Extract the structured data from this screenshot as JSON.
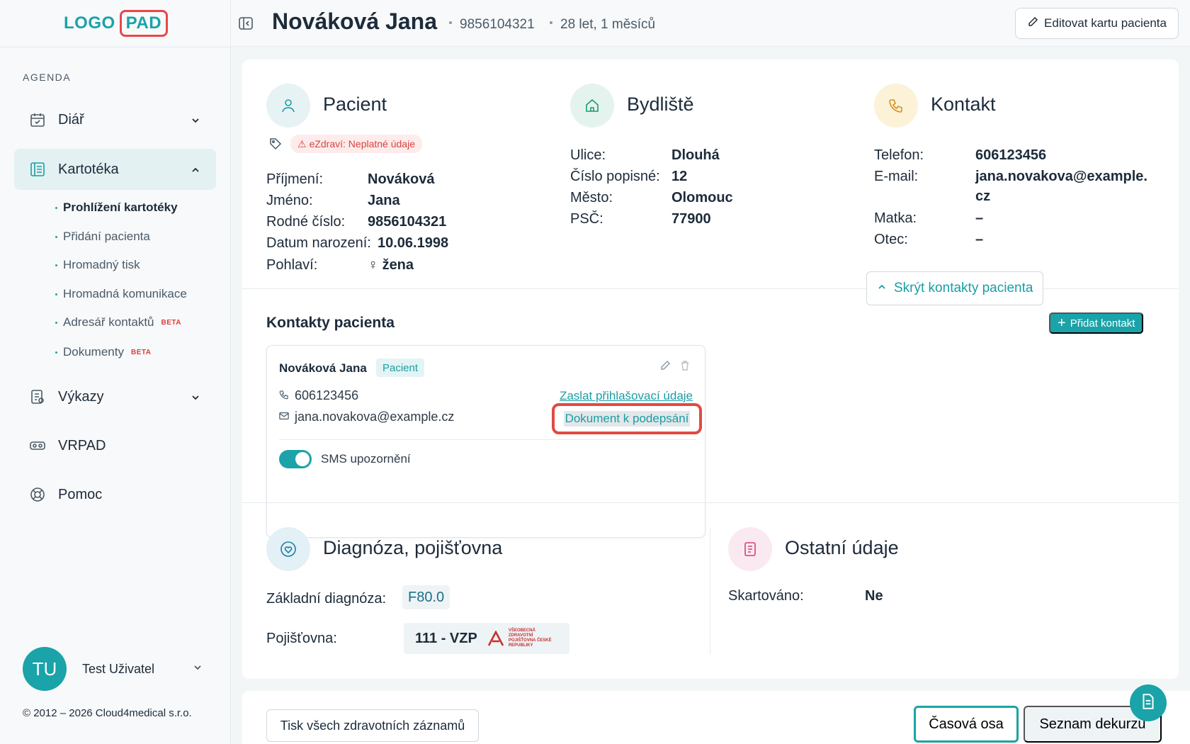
{
  "logo": {
    "part1": "LOGO",
    "part2": "PAD"
  },
  "sidebar": {
    "section_label": "AGENDA",
    "items": [
      {
        "label": "Diář",
        "icon": "calendar-icon"
      },
      {
        "label": "Kartotéka",
        "icon": "file-cabinet-icon"
      },
      {
        "label": "Výkazy",
        "icon": "report-icon"
      },
      {
        "label": "VRPAD",
        "icon": "vr-headset-icon"
      },
      {
        "label": "Pomoc",
        "icon": "lifebuoy-icon"
      }
    ],
    "subitems": [
      {
        "label": "Prohlížení kartotéky"
      },
      {
        "label": "Přidání pacienta"
      },
      {
        "label": "Hromadný tisk"
      },
      {
        "label": "Hromadná komunikace"
      },
      {
        "label": "Adresář kontaktů",
        "badge": "BETA"
      },
      {
        "label": "Dokumenty",
        "badge": "BETA"
      }
    ],
    "user": {
      "initials": "TU",
      "name": "Test Uživatel"
    },
    "copyright": "© 2012 – 2026 Cloud4medical s.r.o."
  },
  "header": {
    "patient_name": "Nováková Jana",
    "birth_number": "9856104321",
    "age": "28 let, 1 měsíců",
    "edit_button": "Editovat kartu pacienta"
  },
  "patient": {
    "title": "Pacient",
    "ezdravi": "eZdraví: Neplatné údaje",
    "fields": [
      {
        "label": "Příjmení:",
        "value": "Nováková"
      },
      {
        "label": "Jméno:",
        "value": "Jana"
      },
      {
        "label": "Rodné číslo:",
        "value": "9856104321"
      },
      {
        "label": "Datum narození:",
        "value": "10.06.1998"
      },
      {
        "label": "Pohlaví:",
        "value": "žena"
      }
    ]
  },
  "residence": {
    "title": "Bydliště",
    "fields": [
      {
        "label": "Ulice:",
        "value": "Dlouhá"
      },
      {
        "label": "Číslo popisné:",
        "value": "12"
      },
      {
        "label": "Město:",
        "value": "Olomouc"
      },
      {
        "label": "PSČ:",
        "value": "77900"
      }
    ]
  },
  "contact": {
    "title": "Kontakt",
    "fields": [
      {
        "label": "Telefon:",
        "value": "606123456"
      },
      {
        "label": "E-mail:",
        "value": "jana.novakova@example.",
        "value2": "cz"
      },
      {
        "label": "Matka:",
        "value": "–"
      },
      {
        "label": "Otec:",
        "value": "–"
      }
    ],
    "hide_button": "Skrýt kontakty pacienta"
  },
  "patient_contacts": {
    "title": "Kontakty pacienta",
    "add_button": "Přidat kontakt",
    "card": {
      "name": "Nováková Jana",
      "badge": "Pacient",
      "phone": "606123456",
      "email": "jana.novakova@example.cz",
      "link_login": "Zaslat přihlašovací údaje",
      "link_document": "Dokument k podepsání",
      "sms_label": "SMS upozornění",
      "sms_enabled": true
    }
  },
  "diagnosis": {
    "title": "Diagnóza, pojišťovna",
    "diagnosis_label": "Základní diagnóza:",
    "diagnosis_value": "F80.0",
    "insurance_label": "Pojišťovna:",
    "insurance_value": "111 - VZP",
    "insurance_logo_text": "VŠEOBECNÁ ZDRAVOTNÍ POJIŠŤOVNA ČESKÉ REPUBLIKY"
  },
  "other": {
    "title": "Ostatní údaje",
    "shredded_label": "Skartováno:",
    "shredded_value": "Ne"
  },
  "bottom": {
    "print_all": "Tisk všech zdravotních záznamů",
    "timeline": "Časová osa",
    "decursus_list": "Seznam dekurzů"
  },
  "colors": {
    "accent": "#1aa3a8",
    "danger": "#e04b43"
  }
}
